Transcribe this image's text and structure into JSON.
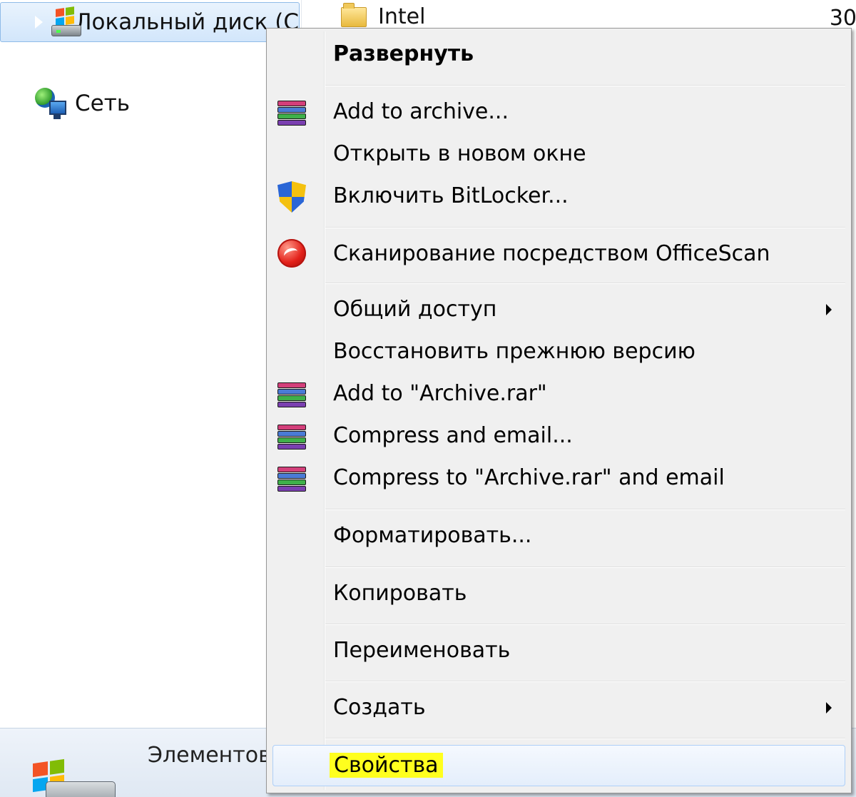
{
  "nav": {
    "drive_label": "Локальный диск (С",
    "network_label": "Сеть"
  },
  "content": {
    "folder_name": "Intel",
    "date_stub": "30"
  },
  "details": {
    "label": "Элементов"
  },
  "colors": {
    "menu_bg": "#f0f0f0",
    "hover_border": "#aecff7",
    "highlight": "#ffff1e",
    "selection_bg": "#d2e6fb"
  },
  "context_menu": {
    "items": [
      {
        "label": "Развернуть",
        "bold": true,
        "icon": null
      },
      {
        "label": "Add to archive...",
        "icon": "winrar-icon"
      },
      {
        "label": "Открыть в новом окне",
        "icon": null
      },
      {
        "label": "Включить BitLocker...",
        "icon": "uac-shield-icon"
      },
      {
        "label": "Сканирование посредством OfficeScan",
        "icon": "officescan-icon"
      },
      {
        "label": "Общий доступ",
        "submenu": true,
        "icon": null
      },
      {
        "label": "Восстановить прежнюю версию",
        "icon": null
      },
      {
        "label": "Add to \"Archive.rar\"",
        "icon": "winrar-icon"
      },
      {
        "label": "Compress and email...",
        "icon": "winrar-icon"
      },
      {
        "label": "Compress to \"Archive.rar\" and email",
        "icon": "winrar-icon"
      },
      {
        "label": "Форматировать...",
        "icon": null
      },
      {
        "label": "Копировать",
        "icon": null
      },
      {
        "label": "Переименовать",
        "icon": null
      },
      {
        "label": "Создать",
        "submenu": true,
        "icon": null
      },
      {
        "label": "Свойства",
        "highlighted": true,
        "hovered": true,
        "icon": null
      }
    ]
  }
}
